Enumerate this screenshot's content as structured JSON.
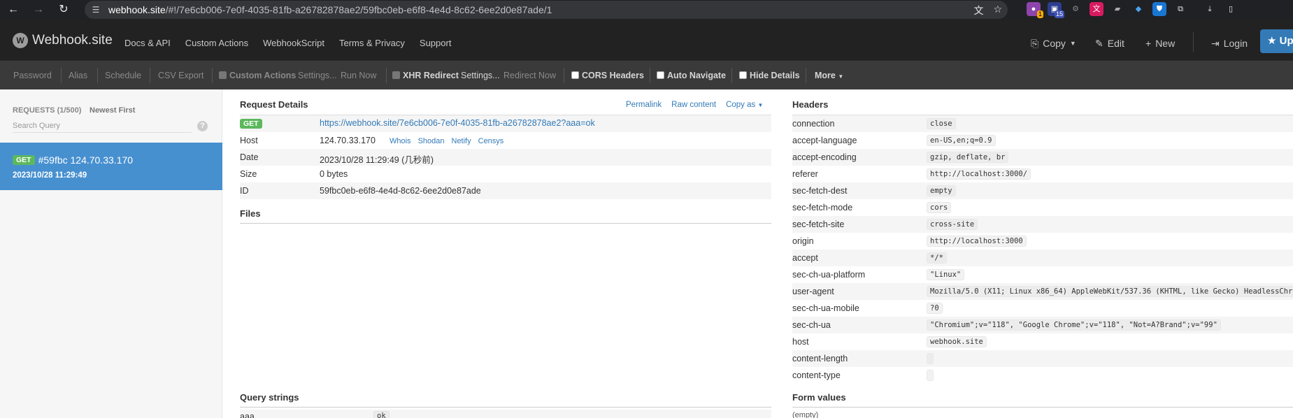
{
  "browser": {
    "url_host": "webhook.site",
    "url_path": "/#!/7e6cb006-7e0f-4035-81fb-a26782878ae2/59fbc0eb-e6f8-4e4d-8c62-6ee2d0e87ade/1",
    "ext_badge_1": "1",
    "ext_badge_2": "15"
  },
  "navbar": {
    "brand": "Webhook.site",
    "links": [
      "Docs & API",
      "Custom Actions",
      "WebhookScript",
      "Terms & Privacy",
      "Support"
    ],
    "copy": "Copy",
    "edit": "Edit",
    "new": "New",
    "login": "Login",
    "upgrade": "Up"
  },
  "toolbar": {
    "password": "Password",
    "alias": "Alias",
    "schedule": "Schedule",
    "csv_export": "CSV Export",
    "custom_actions": "Custom Actions",
    "settings1": "Settings...",
    "run_now": "Run Now",
    "xhr_redirect": "XHR Redirect",
    "settings2": "Settings...",
    "redirect_now": "Redirect Now",
    "cors_headers": "CORS Headers",
    "auto_navigate": "Auto Navigate",
    "hide_details": "Hide Details",
    "more": "More"
  },
  "sidebar": {
    "count": "REQUESTS (1/500)",
    "sort": "Newest First",
    "search_placeholder": "Search Query",
    "help": "?",
    "request": {
      "method": "GET",
      "title": "#59fbc 124.70.33.170",
      "time": "2023/10/28 11:29:49"
    }
  },
  "details": {
    "title": "Request Details",
    "permalink": "Permalink",
    "raw": "Raw content",
    "copy_as": "Copy as",
    "method": "GET",
    "url": "https://webhook.site/7e6cb006-7e0f-4035-81fb-a26782878ae2?aaa=ok",
    "host_label": "Host",
    "host": "124.70.33.170",
    "host_links": [
      "Whois",
      "Shodan",
      "Netify",
      "Censys"
    ],
    "date_label": "Date",
    "date": "2023/10/28 11:29:49 (几秒前)",
    "size_label": "Size",
    "size": "0 bytes",
    "id_label": "ID",
    "id": "59fbc0eb-e6f8-4e4d-8c62-6ee2d0e87ade",
    "files_title": "Files",
    "query_title": "Query strings",
    "query_key": "aaa",
    "query_val": "ok"
  },
  "headers": {
    "title": "Headers",
    "rows": [
      {
        "k": "connection",
        "v": "close"
      },
      {
        "k": "accept-language",
        "v": "en-US,en;q=0.9"
      },
      {
        "k": "accept-encoding",
        "v": "gzip, deflate, br"
      },
      {
        "k": "referer",
        "v": "http://localhost:3000/"
      },
      {
        "k": "sec-fetch-dest",
        "v": "empty"
      },
      {
        "k": "sec-fetch-mode",
        "v": "cors"
      },
      {
        "k": "sec-fetch-site",
        "v": "cross-site"
      },
      {
        "k": "origin",
        "v": "http://localhost:3000"
      },
      {
        "k": "accept",
        "v": "*/*"
      },
      {
        "k": "sec-ch-ua-platform",
        "v": "\"Linux\""
      },
      {
        "k": "user-agent",
        "v": "Mozilla/5.0 (X11; Linux x86_64) AppleWebKit/537.36 (KHTML, like Gecko) HeadlessChrom"
      },
      {
        "k": "sec-ch-ua-mobile",
        "v": "?0"
      },
      {
        "k": "sec-ch-ua",
        "v": "\"Chromium\";v=\"118\", \"Google Chrome\";v=\"118\", \"Not=A?Brand\";v=\"99\""
      },
      {
        "k": "host",
        "v": "webhook.site"
      },
      {
        "k": "content-length",
        "v": ""
      },
      {
        "k": "content-type",
        "v": ""
      }
    ],
    "form_title": "Form values",
    "form_empty": "(empty)"
  }
}
